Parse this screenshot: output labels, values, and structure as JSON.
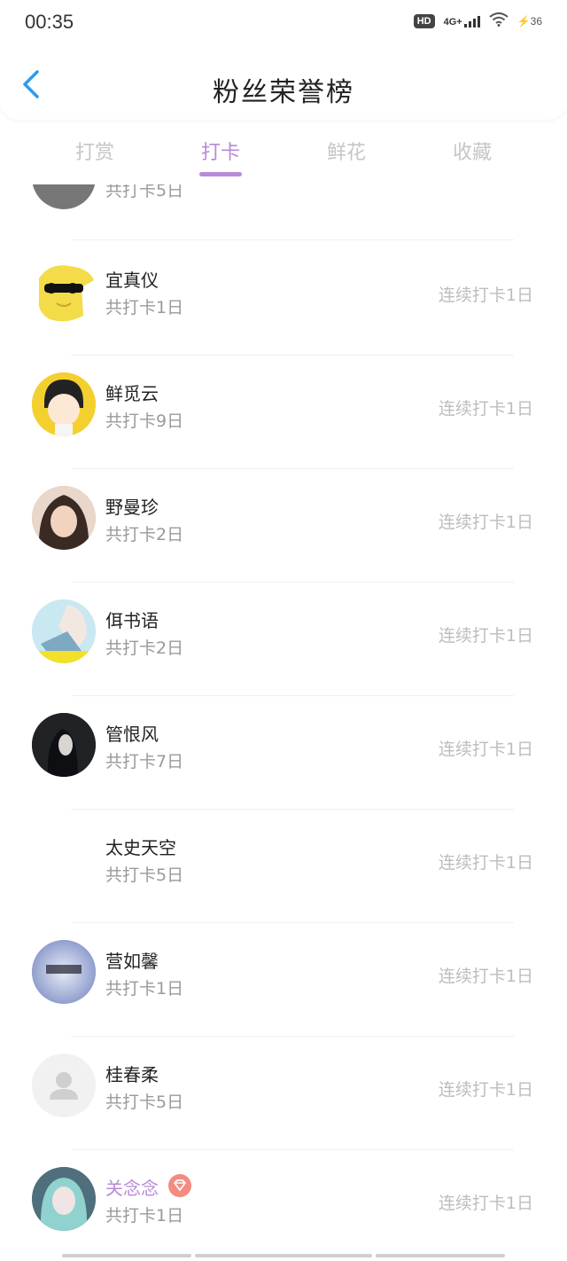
{
  "status_bar": {
    "time": "00:35",
    "hd": "HD",
    "network": "4G+",
    "battery": "36"
  },
  "header": {
    "title": "粉丝荣誉榜",
    "back_icon": "chevron-left-icon",
    "accent_color": "#2b9cf0"
  },
  "tabs": [
    {
      "label": "打赏",
      "active": false
    },
    {
      "label": "打卡",
      "active": true
    },
    {
      "label": "鲜花",
      "active": false
    },
    {
      "label": "收藏",
      "active": false
    }
  ],
  "colors": {
    "active_tab": "#b98ad6",
    "inactive_tab": "#c6c6c6",
    "muted_text": "#9a9a9a",
    "streak_text": "#bdbdbd",
    "vip_badge": "#f58a7e"
  },
  "partial_row": {
    "total": "共打卡5日"
  },
  "list": [
    {
      "name": "宜真仪",
      "total": "共打卡1日",
      "streak": "连续打卡1日",
      "avatar": "yellow-cartoon-sunglasses"
    },
    {
      "name": "鲜觅云",
      "total": "共打卡9日",
      "streak": "连续打卡1日",
      "avatar": "cartoon-girl-yellow"
    },
    {
      "name": "野曼珍",
      "total": "共打卡2日",
      "streak": "连续打卡1日",
      "avatar": "child-photo"
    },
    {
      "name": "佴书语",
      "total": "共打卡2日",
      "streak": "连续打卡1日",
      "avatar": "anime-photo-light"
    },
    {
      "name": "管恨风",
      "total": "共打卡7日",
      "streak": "连续打卡1日",
      "avatar": "dark-portrait"
    },
    {
      "name": "太史天空",
      "total": "共打卡5日",
      "streak": "连续打卡1日",
      "avatar": "blank"
    },
    {
      "name": "营如馨",
      "total": "共打卡1日",
      "streak": "连续打卡1日",
      "avatar": "blue-sky-text"
    },
    {
      "name": "桂春柔",
      "total": "共打卡5日",
      "streak": "连续打卡1日",
      "avatar": "default-person"
    },
    {
      "name": "关念念",
      "total": "共打卡1日",
      "streak": "连续打卡1日",
      "avatar": "anime-girl-teal",
      "vip": true
    }
  ]
}
